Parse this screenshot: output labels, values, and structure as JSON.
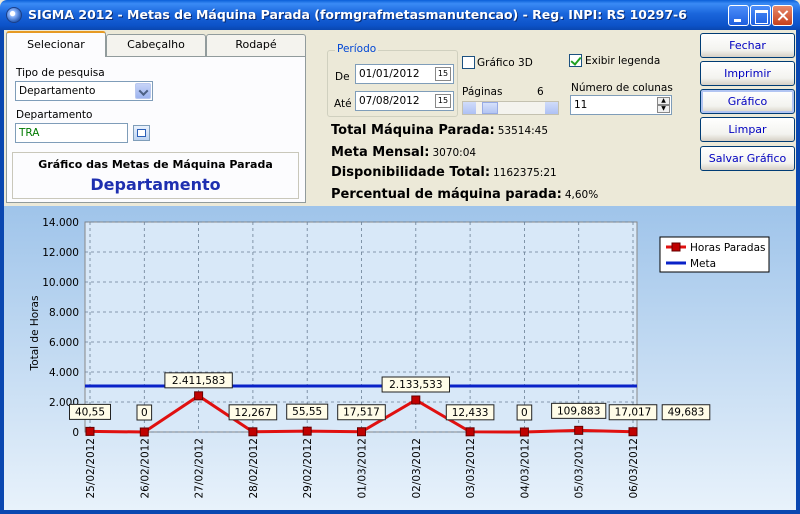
{
  "window": {
    "title": "SIGMA 2012 - Metas de Máquina Parada  (formgrafmetasmanutencao)  - Reg. INPI: RS 10297-6"
  },
  "tabs": [
    "Selecionar",
    "Cabeçalho",
    "Rodapé"
  ],
  "form": {
    "tipo_label": "Tipo de pesquisa",
    "tipo_value": "Departamento",
    "depto_label": "Departamento",
    "depto_value": "TRA",
    "box_title": "Gráfico das Metas de Máquina Parada",
    "box_subtitle": "Departamento"
  },
  "periodo": {
    "legend": "Período",
    "de_label": "De",
    "de_value": "01/01/2012",
    "ate_label": "Até",
    "ate_value": "07/08/2012",
    "cal_icon": "15"
  },
  "options": {
    "grafico3d_label": "Gráfico 3D",
    "grafico3d_checked": false,
    "legenda_label": "Exibir legenda",
    "legenda_checked": true,
    "paginas_label": "Páginas",
    "paginas_value": "6",
    "colunas_label": "Número de colunas",
    "colunas_value": "11"
  },
  "stats": {
    "total_label": "Total Máquina Parada:",
    "total_value": "53514:45",
    "meta_label": "Meta Mensal:",
    "meta_value": "3070:04",
    "disp_label": "Disponibilidade Total:",
    "disp_value": "1162375:21",
    "perc_label": "Percentual de máquina parada:",
    "perc_value": "4,60%"
  },
  "buttons": [
    "Fechar",
    "Imprimir",
    "Gráfico",
    "Limpar",
    "Salvar Gráfico"
  ],
  "colors": {
    "series": "#e01010",
    "meta": "#0a22c8"
  },
  "chart_data": {
    "type": "line",
    "ylabel": "Total de Horas",
    "ylim": [
      0,
      14000
    ],
    "yticks": [
      "0",
      "2.000",
      "4.000",
      "6.000",
      "8.000",
      "10.000",
      "12.000",
      "14.000"
    ],
    "grid": true,
    "legend_position": "top-right",
    "categories": [
      "25/02/2012",
      "26/02/2012",
      "27/02/2012",
      "28/02/2012",
      "29/02/2012",
      "01/03/2012",
      "02/03/2012",
      "03/03/2012",
      "04/03/2012",
      "05/03/2012",
      "06/03/2012"
    ],
    "series": [
      {
        "name": "Horas Paradas",
        "values": [
          40.55,
          0,
          2411.583,
          12.267,
          55.55,
          17.517,
          2133.533,
          12.433,
          0,
          109.883,
          17.017
        ],
        "labels": [
          "40,55",
          "0",
          "2.411,583",
          "12,267",
          "55,55",
          "17,517",
          "2.133,533",
          "12,433",
          "0",
          "109,883",
          "17,017"
        ]
      },
      {
        "name": "Meta",
        "values": [
          3070.07,
          3070.07,
          3070.07,
          3070.07,
          3070.07,
          3070.07,
          3070.07,
          3070.07,
          3070.07,
          3070.07,
          3070.07
        ]
      }
    ],
    "extra_label": "49,683"
  }
}
